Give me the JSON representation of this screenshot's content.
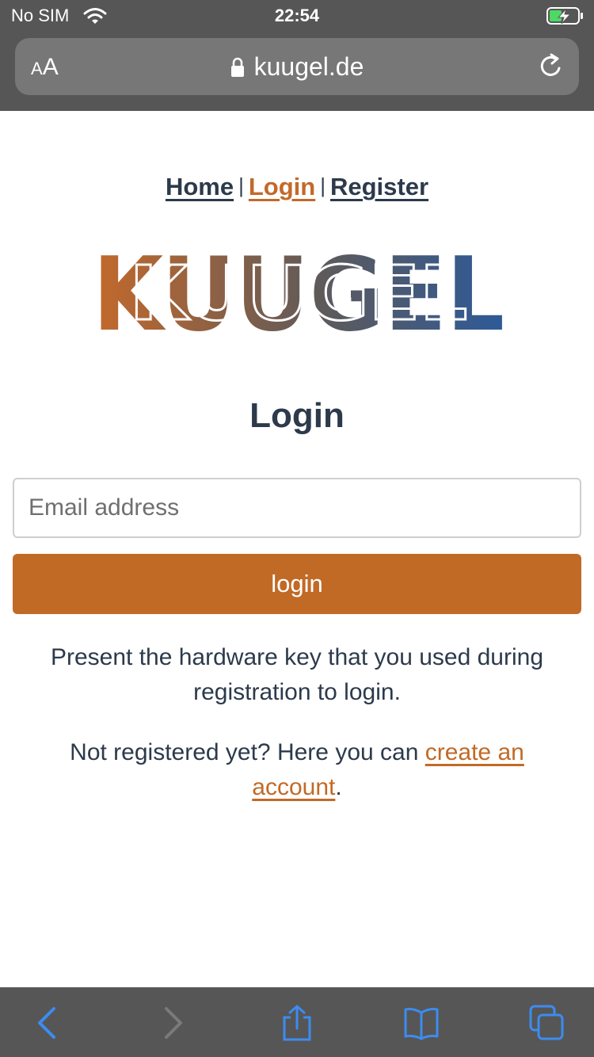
{
  "status_bar": {
    "carrier": "No SIM",
    "time": "22:54"
  },
  "url_bar": {
    "text_size_label_small": "A",
    "text_size_label_large": "A",
    "url": "kuugel.de"
  },
  "nav": {
    "home": "Home",
    "separator": "|",
    "login": "Login",
    "register": "Register"
  },
  "logo": {
    "text": "KUUGEL",
    "gradient_start": "#c4692b",
    "gradient_end": "#2d5a98"
  },
  "page": {
    "title": "Login",
    "email_placeholder": "Email address",
    "email_value": "",
    "login_button": "login",
    "info": "Present the hardware key that you used during registration to login.",
    "register_prefix": "Not registered yet? Here you can ",
    "register_link": "create an account",
    "register_suffix": "."
  },
  "colors": {
    "accent": "#c16a26",
    "text": "#2c3a4b",
    "chrome": "#565656",
    "toolbar_icons": "#3c8cf0"
  },
  "toolbar": {
    "icons": [
      "back-icon",
      "forward-icon",
      "share-icon",
      "bookmarks-icon",
      "tabs-icon"
    ]
  }
}
